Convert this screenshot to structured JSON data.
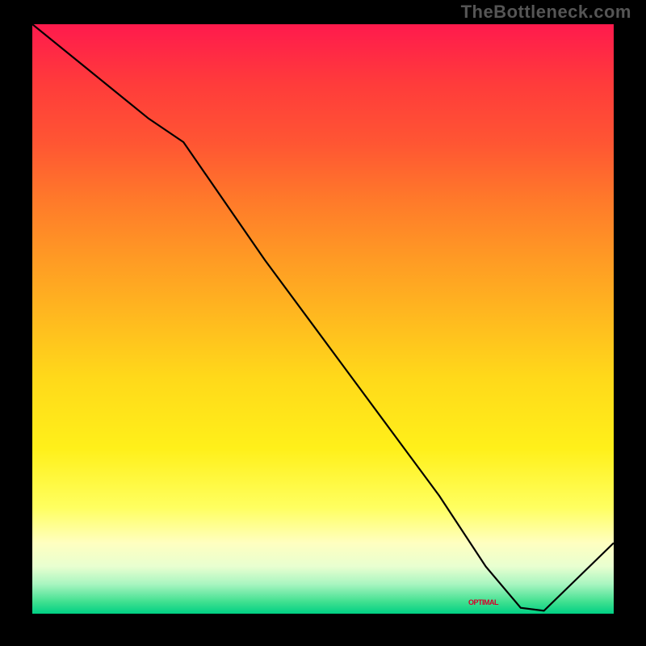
{
  "attribution": "TheBottleneck.com",
  "chart_data": {
    "type": "line",
    "title": "",
    "xlabel": "",
    "ylabel": "",
    "xlim": [
      0,
      100
    ],
    "ylim": [
      0,
      100
    ],
    "x": [
      0,
      10,
      20,
      26,
      40,
      55,
      70,
      78,
      84,
      88,
      100
    ],
    "values": [
      100,
      92,
      84,
      80,
      60,
      40,
      20,
      8,
      1,
      0.5,
      12
    ],
    "marker_label": "OPTIMAL",
    "gradient_meaning": "red=bottleneck, green=optimal"
  }
}
